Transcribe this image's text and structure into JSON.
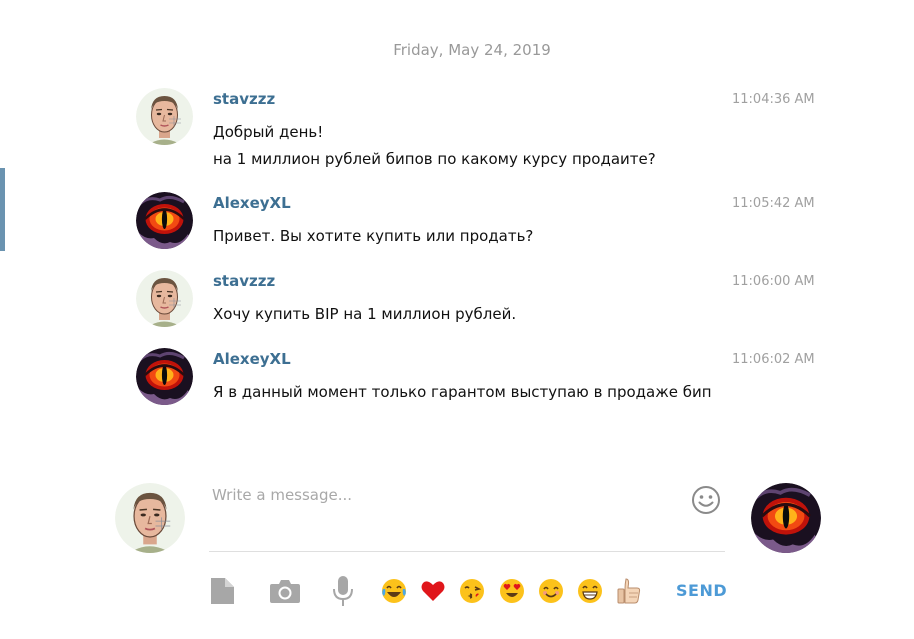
{
  "date_separator": "Friday, May 24, 2019",
  "messages": [
    {
      "author": "stavzzz",
      "time": "11:04:36 AM",
      "avatar": "face-avatar",
      "lines": [
        "Добрый день!",
        "на 1 миллион рублей бипов по какому курсу продаите?"
      ]
    },
    {
      "author": "AlexeyXL",
      "time": "11:05:42 AM",
      "avatar": "dragon-eye-avatar",
      "lines": [
        "Привет. Вы хотите купить или продать?"
      ]
    },
    {
      "author": "stavzzz",
      "time": "11:06:00 AM",
      "avatar": "face-avatar",
      "lines": [
        "Хочу купить BIP на 1 миллион рублей."
      ]
    },
    {
      "author": "AlexeyXL",
      "time": "11:06:02 AM",
      "avatar": "dragon-eye-avatar",
      "lines": [
        "Я в данный момент только гарантом выступаю в продаже бип"
      ]
    }
  ],
  "composer": {
    "placeholder": "Write a message...",
    "send_label": "SEND",
    "tools": [
      "file-icon",
      "camera-icon",
      "microphone-icon"
    ],
    "quick_emoji": [
      "tears-of-joy",
      "red-heart",
      "kissing-face",
      "heart-eyes",
      "smiling-face",
      "grinning-face",
      "thumbs-up"
    ]
  },
  "colors": {
    "author": "#3d6f92",
    "send": "#4d9ad6",
    "accent_bar": "#6a93b0"
  }
}
